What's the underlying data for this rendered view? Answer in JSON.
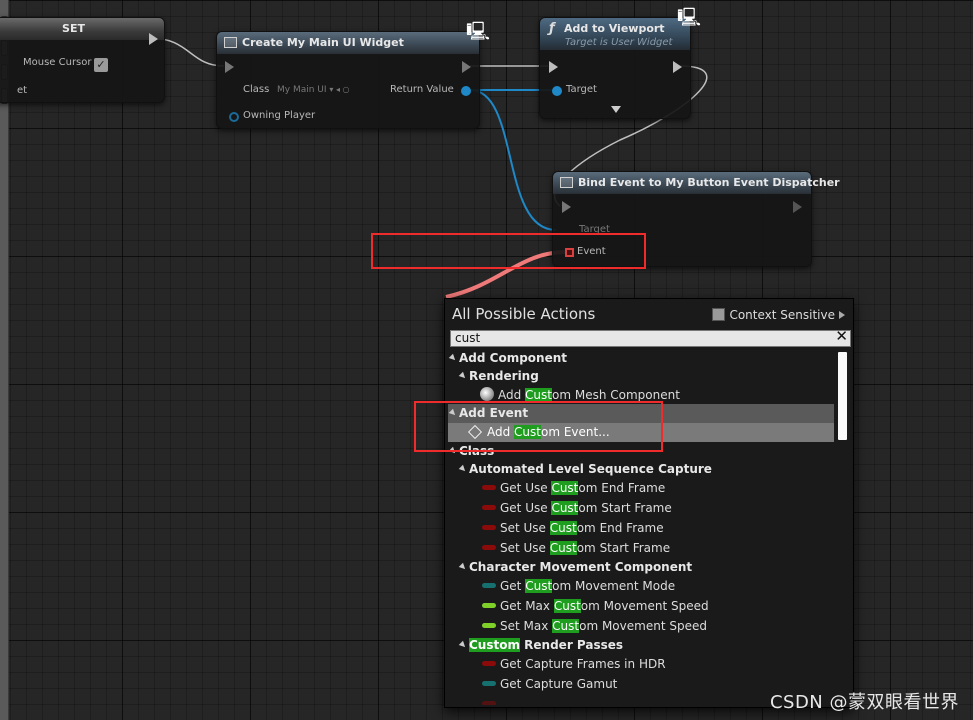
{
  "nodes": {
    "set": {
      "title": "SET",
      "mouse_cursor_label": "Mouse Cursor",
      "partial_label": "et"
    },
    "create_widget": {
      "title": "Create My Main UI Widget",
      "class_label": "Class",
      "class_value": "My Main UI",
      "return_label": "Return Value",
      "owning_label": "Owning Player"
    },
    "add_viewport": {
      "title": "Add to Viewport",
      "subtitle": "Target is User Widget",
      "target_label": "Target"
    },
    "bind_event": {
      "title": "Bind Event to My Button Event Dispatcher",
      "target_label": "Target",
      "event_label": "Event"
    }
  },
  "popup": {
    "title": "All Possible Actions",
    "context_sensitive": "Context Sensitive",
    "search_value": "cust",
    "rows": {
      "add_component": "Add Component",
      "rendering": "Rendering",
      "mesh_pre": "Add ",
      "mesh_hl": "Cust",
      "mesh_post": "om Mesh Component",
      "add_event": "Add Event",
      "event_pre": "Add ",
      "event_hl": "Cust",
      "event_post": "om Event...",
      "class": "Class",
      "alsc": "Automated Level Sequence Capture",
      "r1_pre": "Get Use ",
      "r1_hl": "Cust",
      "r1_post": "om End Frame",
      "r2_pre": "Get Use ",
      "r2_hl": "Cust",
      "r2_post": "om Start Frame",
      "r3_pre": "Set Use ",
      "r3_hl": "Cust",
      "r3_post": "om End Frame",
      "r4_pre": "Set Use ",
      "r4_hl": "Cust",
      "r4_post": "om Start Frame",
      "cmc": "Character Movement Component",
      "r5_pre": "Get ",
      "r5_hl": "Cust",
      "r5_post": "om Movement Mode",
      "r6_pre": "Get Max ",
      "r6_hl": "Cust",
      "r6_post": "om Movement Speed",
      "r7_pre": "Set Max ",
      "r7_hl": "Cust",
      "r7_post": "om Movement Speed",
      "crp_hl": "Custom",
      "crp_post": " Render Passes",
      "r8": "Get Capture Frames in HDR",
      "r9": "Get Capture Gamut"
    }
  },
  "watermark": "CSDN @蒙双眼看世界",
  "colors": {
    "highlight": "#1f9d1f",
    "annotation": "#ef2b2b",
    "exec_wire": "#e8e8e8",
    "object_wire": "#1f88c7",
    "delegate_wire": "#f07a7a"
  }
}
